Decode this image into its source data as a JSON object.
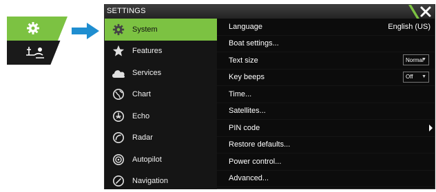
{
  "tile": {
    "top_icon": "gear-icon",
    "bottom_icon": "boat-settings-icon",
    "accent_color": "#7cc242"
  },
  "arrow_color": "#1f8ed0",
  "window": {
    "title": "SETTINGS",
    "close_icon": "close-icon"
  },
  "sidebar": {
    "items": [
      {
        "label": "System",
        "icon": "gear-icon",
        "active": true
      },
      {
        "label": "Features",
        "icon": "star-icon"
      },
      {
        "label": "Services",
        "icon": "cloud-icon"
      },
      {
        "label": "Chart",
        "icon": "globe-icon"
      },
      {
        "label": "Echo",
        "icon": "echo-icon"
      },
      {
        "label": "Radar",
        "icon": "radar-icon"
      },
      {
        "label": "Autopilot",
        "icon": "autopilot-icon"
      },
      {
        "label": "Navigation",
        "icon": "navigation-icon"
      }
    ]
  },
  "settings": {
    "rows": [
      {
        "label": "Language",
        "value": "English (US)"
      },
      {
        "label": "Boat settings..."
      },
      {
        "label": "Text size",
        "dropdown": "Normal"
      },
      {
        "label": "Key beeps",
        "dropdown": "Off"
      },
      {
        "label": "Time..."
      },
      {
        "label": "Satellites..."
      },
      {
        "label": "PIN code",
        "submenu": true
      },
      {
        "label": "Restore defaults..."
      },
      {
        "label": "Power control..."
      },
      {
        "label": "Advanced..."
      }
    ]
  }
}
